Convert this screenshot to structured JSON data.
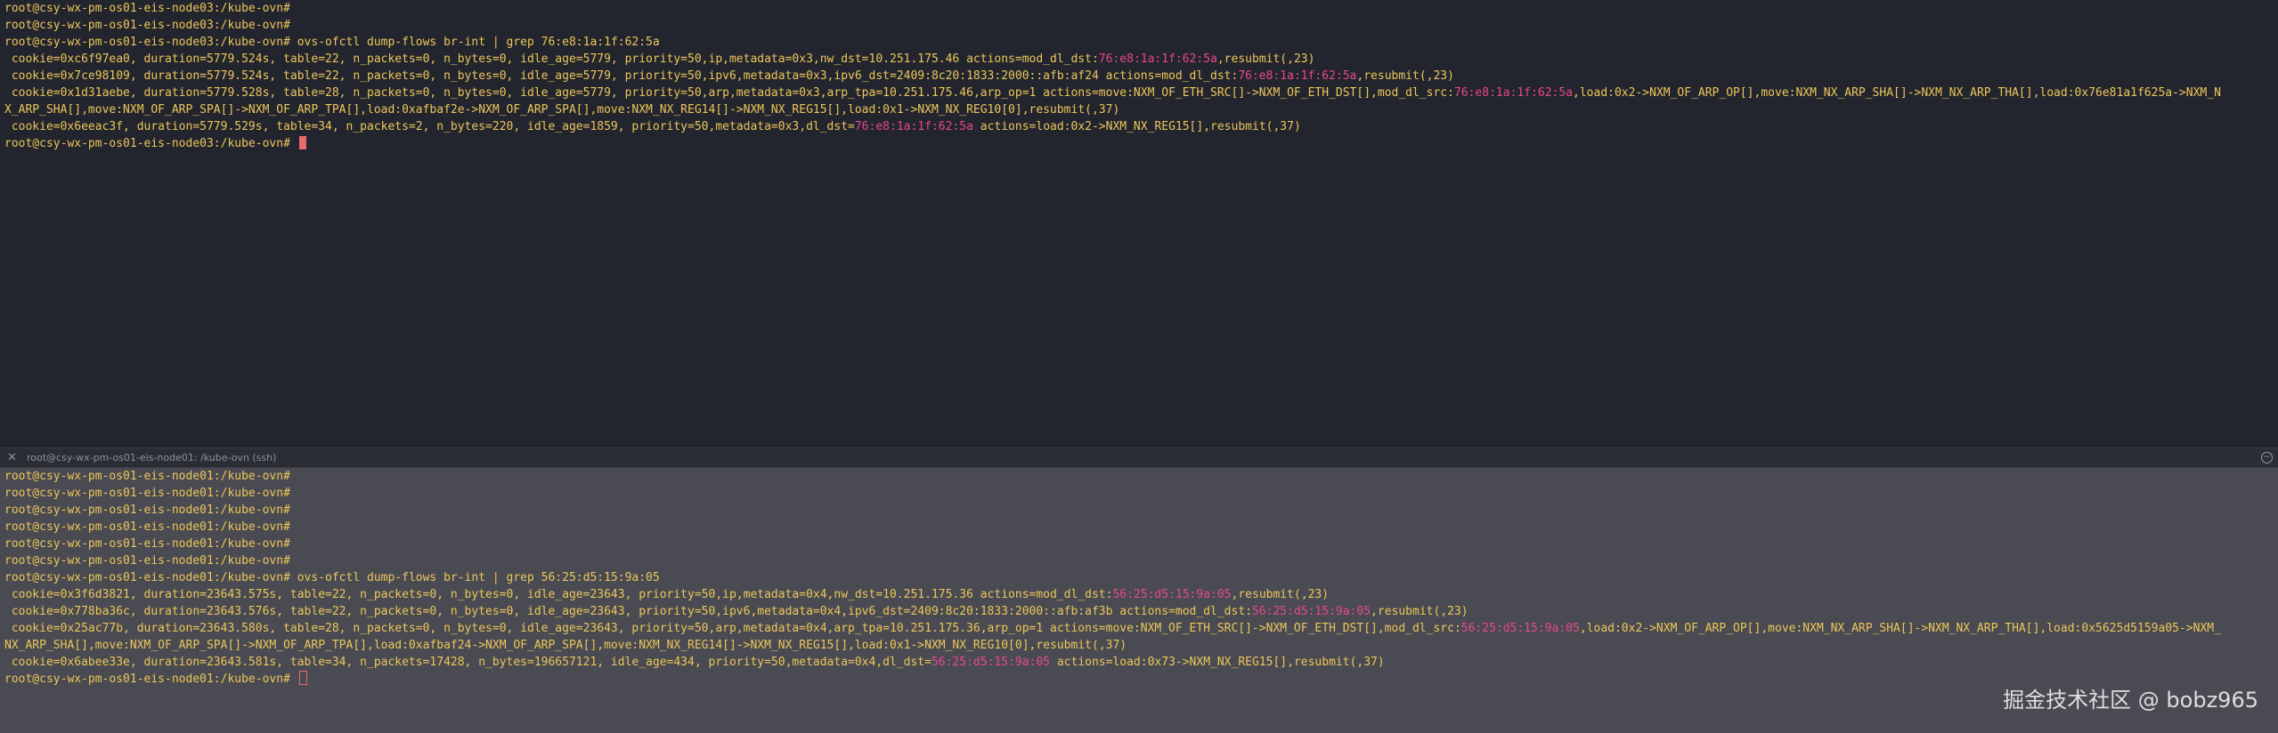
{
  "top": {
    "lines": [
      {
        "text": "root@csy-wx-pm-os01-eis-node03:/kube-ovn#"
      },
      {
        "text": "root@csy-wx-pm-os01-eis-node03:/kube-ovn#"
      },
      {
        "text": "root@csy-wx-pm-os01-eis-node03:/kube-ovn# ovs-ofctl dump-flows br-int | grep 76:e8:1a:1f:62:5a"
      },
      {
        "text": " cookie=0xc6f97ea0, duration=5779.524s, table=22, n_packets=0, n_bytes=0, idle_age=5779, priority=50,ip,metadata=0x3,nw_dst=10.251.175.46 actions=mod_dl_dst:76:e8:1a:1f:62:5a,resubmit(,23)"
      },
      {
        "text": " cookie=0x7ce98109, duration=5779.524s, table=22, n_packets=0, n_bytes=0, idle_age=5779, priority=50,ipv6,metadata=0x3,ipv6_dst=2409:8c20:1833:2000::afb:af24 actions=mod_dl_dst:76:e8:1a:1f:62:5a,resubmit(,23)"
      },
      {
        "text": " cookie=0x1d31aebe, duration=5779.528s, table=28, n_packets=0, n_bytes=0, idle_age=5779, priority=50,arp,metadata=0x3,arp_tpa=10.251.175.46,arp_op=1 actions=move:NXM_OF_ETH_SRC[]->NXM_OF_ETH_DST[],mod_dl_src:76:e8:1a:1f:62:5a,load:0x2->NXM_OF_ARP_OP[],move:NXM_NX_ARP_SHA[]->NXM_NX_ARP_THA[],load:0x76e81a1f625a->NXM_N"
      },
      {
        "text": "X_ARP_SHA[],move:NXM_OF_ARP_SPA[]->NXM_OF_ARP_TPA[],load:0xafbaf2e->NXM_OF_ARP_SPA[],move:NXM_NX_REG14[]->NXM_NX_REG15[],load:0x1->NXM_NX_REG10[0],resubmit(,37)"
      },
      {
        "text": " cookie=0x6eeac3f, duration=5779.529s, table=34, n_packets=2, n_bytes=220, idle_age=1859, priority=50,metadata=0x3,dl_dst=76:e8:1a:1f:62:5a actions=load:0x2->NXM_NX_REG15[],resubmit(,37)"
      },
      {
        "text": "root@csy-wx-pm-os01-eis-node03:/kube-ovn# "
      }
    ],
    "mac": "76:e8:1a:1f:62:5a"
  },
  "tab": {
    "close_icon": "close-icon",
    "title": "root@csy-wx-pm-os01-eis-node01: /kube-ovn (ssh)"
  },
  "bottom": {
    "lines": [
      {
        "text": "root@csy-wx-pm-os01-eis-node01:/kube-ovn#"
      },
      {
        "text": "root@csy-wx-pm-os01-eis-node01:/kube-ovn#"
      },
      {
        "text": "root@csy-wx-pm-os01-eis-node01:/kube-ovn#"
      },
      {
        "text": "root@csy-wx-pm-os01-eis-node01:/kube-ovn#"
      },
      {
        "text": "root@csy-wx-pm-os01-eis-node01:/kube-ovn#"
      },
      {
        "text": "root@csy-wx-pm-os01-eis-node01:/kube-ovn#"
      },
      {
        "text": "root@csy-wx-pm-os01-eis-node01:/kube-ovn# ovs-ofctl dump-flows br-int | grep 56:25:d5:15:9a:05"
      },
      {
        "text": " cookie=0x3f6d3821, duration=23643.575s, table=22, n_packets=0, n_bytes=0, idle_age=23643, priority=50,ip,metadata=0x4,nw_dst=10.251.175.36 actions=mod_dl_dst:56:25:d5:15:9a:05,resubmit(,23)"
      },
      {
        "text": " cookie=0x778ba36c, duration=23643.576s, table=22, n_packets=0, n_bytes=0, idle_age=23643, priority=50,ipv6,metadata=0x4,ipv6_dst=2409:8c20:1833:2000::afb:af3b actions=mod_dl_dst:56:25:d5:15:9a:05,resubmit(,23)"
      },
      {
        "text": " cookie=0x25ac77b, duration=23643.580s, table=28, n_packets=0, n_bytes=0, idle_age=23643, priority=50,arp,metadata=0x4,arp_tpa=10.251.175.36,arp_op=1 actions=move:NXM_OF_ETH_SRC[]->NXM_OF_ETH_DST[],mod_dl_src:56:25:d5:15:9a:05,load:0x2->NXM_OF_ARP_OP[],move:NXM_NX_ARP_SHA[]->NXM_NX_ARP_THA[],load:0x5625d5159a05->NXM_"
      },
      {
        "text": "NX_ARP_SHA[],move:NXM_OF_ARP_SPA[]->NXM_OF_ARP_TPA[],load:0xafbaf24->NXM_OF_ARP_SPA[],move:NXM_NX_REG14[]->NXM_NX_REG15[],load:0x1->NXM_NX_REG10[0],resubmit(,37)"
      },
      {
        "text": " cookie=0x6abee33e, duration=23643.581s, table=34, n_packets=17428, n_bytes=196657121, idle_age=434, priority=50,metadata=0x4,dl_dst=56:25:d5:15:9a:05 actions=load:0x73->NXM_NX_REG15[],resubmit(,37)"
      },
      {
        "text": "root@csy-wx-pm-os01-eis-node01:/kube-ovn# "
      }
    ],
    "mac": "56:25:d5:15:9a:05"
  },
  "watermark": "掘金技术社区 @ bobz965",
  "colors": {
    "prompt": "#ecc65a",
    "mac_highlight": "#e8488a",
    "cursor": "#e96a6a",
    "top_bg": "#23252e",
    "bottom_bg": "#4a4b52"
  }
}
